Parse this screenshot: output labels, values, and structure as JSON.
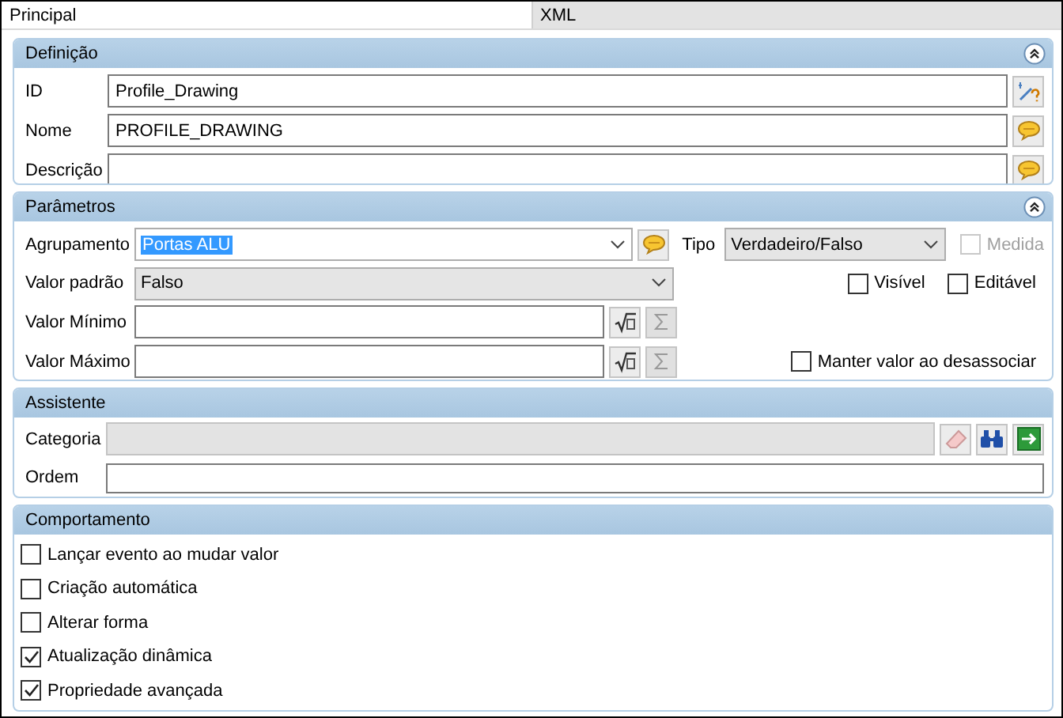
{
  "tabs": [
    {
      "label": "Principal",
      "selected": true
    },
    {
      "label": "XML",
      "selected": false
    }
  ],
  "definicao": {
    "title": "Definição",
    "collapsible": true,
    "fields": [
      {
        "label": "ID",
        "value": "Profile_Drawing",
        "kind": "generate"
      },
      {
        "label": "Nome",
        "value": "PROFILE_DRAWING",
        "kind": "translate"
      },
      {
        "label": "Descrição",
        "kind": "translate"
      }
    ]
  },
  "parametros": {
    "title": "Parâmetros",
    "collapsible": true,
    "agrupamento": {
      "label": "Agrupamento",
      "value": "Portas ALU",
      "text_selected": true
    },
    "tipo": {
      "label": "Tipo",
      "value": "Verdadeiro/Falso"
    },
    "medida": {
      "label": "Medida",
      "checked": false,
      "disabled": true
    },
    "valor_padrao": {
      "label": "Valor padrão",
      "value": "Falso"
    },
    "visivel": {
      "label": "Visível",
      "checked": false,
      "disabled": false
    },
    "editavel": {
      "label": "Editável",
      "checked": false,
      "disabled": false
    },
    "valor_minimo": {
      "label": "Valor Mínimo"
    },
    "valor_maximo": {
      "label": "Valor Máximo"
    },
    "manter": {
      "label": "Manter valor ao desassociar",
      "checked": false,
      "disabled": false
    }
  },
  "assistente": {
    "title": "Assistente",
    "collapsible": false,
    "categoria": {
      "label": "Categoria",
      "disabled": true
    },
    "ordem": {
      "label": "Ordem"
    }
  },
  "comportamento": {
    "title": "Comportamento",
    "collapsible": false,
    "options": [
      {
        "label": "Lançar evento ao mudar valor",
        "checked": false
      },
      {
        "label": "Criação automática",
        "checked": false
      },
      {
        "label": "Alterar forma",
        "checked": false
      },
      {
        "label": "Atualização dinâmica",
        "checked": true
      },
      {
        "label": "Propriedade avançada",
        "checked": true
      }
    ]
  }
}
